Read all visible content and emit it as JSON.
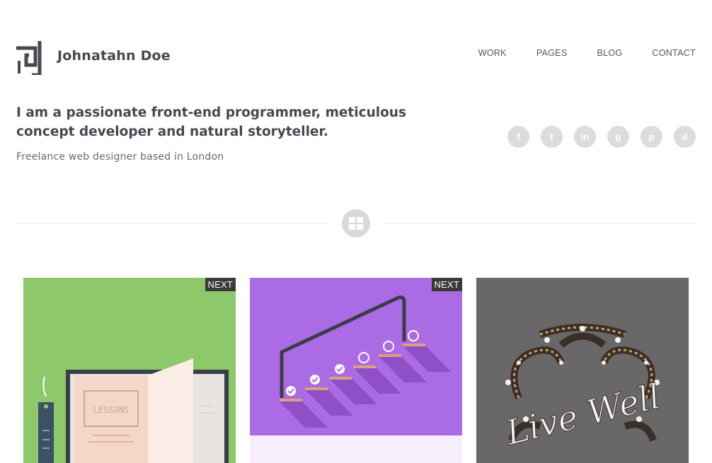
{
  "brand": {
    "name": "Johnatahn Doe",
    "logo_icon": "bracket-square-logo"
  },
  "nav": {
    "items": [
      "WORK",
      "PAGES",
      "BLOG",
      "CONTACT"
    ]
  },
  "intro": {
    "tagline": "I am a passionate front-end programmer, meticulous concept developer and natural storyteller.",
    "subline": "Freelance web designer based in London"
  },
  "social": {
    "icons": [
      "facebook-icon",
      "twitter-icon",
      "linkedin-icon",
      "google-icon",
      "pinterest-icon",
      "dribbble-icon"
    ],
    "glyphs": [
      "f",
      "t",
      "in",
      "g",
      "p",
      "d"
    ]
  },
  "divider": {
    "icon": "grid-icon"
  },
  "portfolio": [
    {
      "badge": "NEXT",
      "image": "book-lessons-illustration",
      "image_text": "LESSONS",
      "bg": "#8dc86a"
    },
    {
      "badge": "NEXT",
      "image": "stairs-checklist-illustration",
      "bg": "#ab6be4"
    },
    {
      "badge": "",
      "image": "live-well-lettering",
      "image_text": "Live Well",
      "bg": "#696767"
    }
  ],
  "colors": {
    "accent": "#4a4650",
    "social_bg": "#dcdcdc",
    "divider_icon_bg": "#d9d9d9"
  }
}
